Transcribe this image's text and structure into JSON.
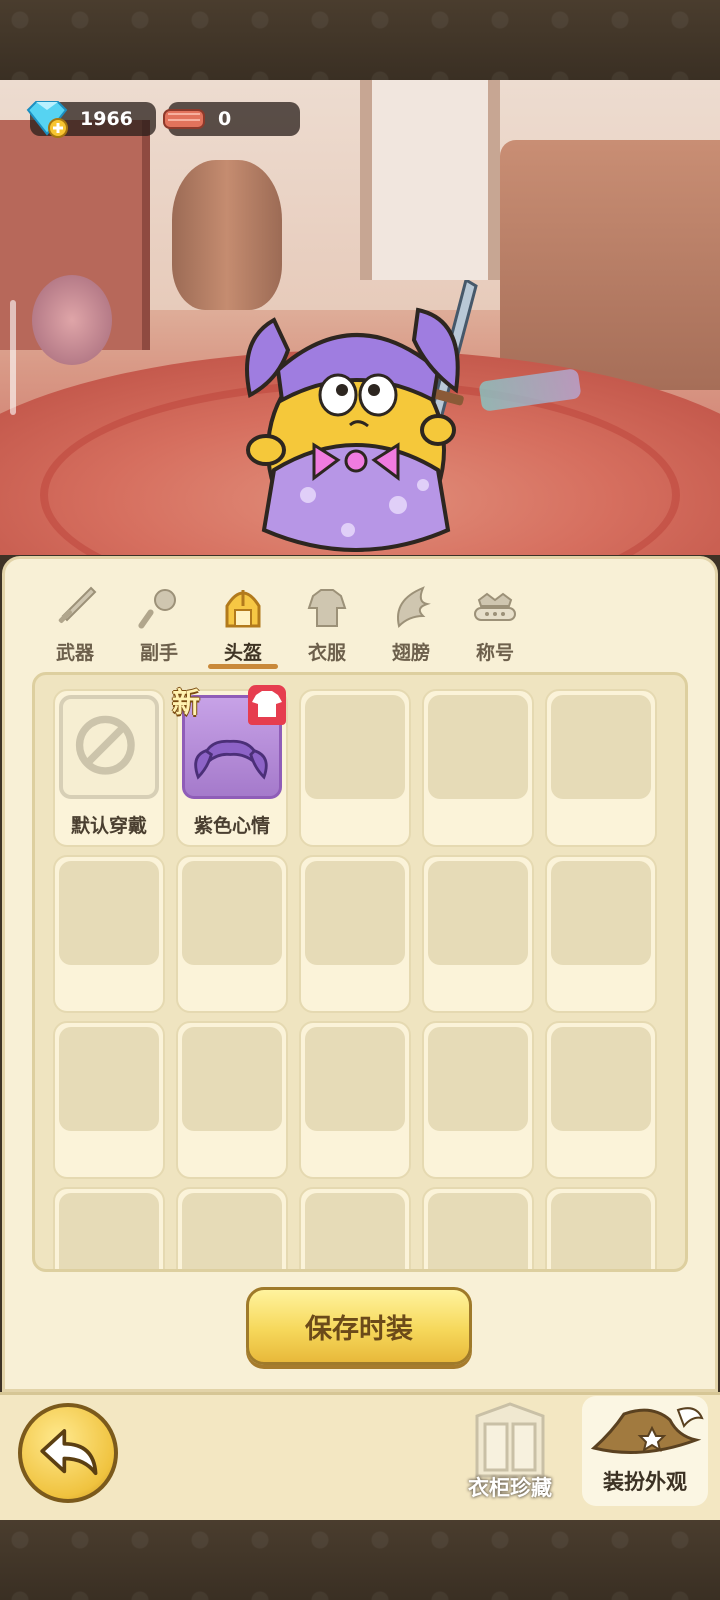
{
  "currency": {
    "gems": "1966",
    "cloth": "0"
  },
  "tabs": [
    {
      "label": "武器",
      "icon": "sword-icon",
      "active": false
    },
    {
      "label": "副手",
      "icon": "offhand-icon",
      "active": false
    },
    {
      "label": "头盔",
      "icon": "helmet-icon",
      "active": true
    },
    {
      "label": "衣服",
      "icon": "armor-icon",
      "active": false
    },
    {
      "label": "翅膀",
      "icon": "wing-icon",
      "active": false
    },
    {
      "label": "称号",
      "icon": "title-crown-icon",
      "active": false
    }
  ],
  "items": [
    {
      "label": "默认穿戴",
      "icon": "forbidden-icon"
    },
    {
      "label": "紫色心情",
      "icon": "purple-pigtails-icon",
      "new_tag": "新",
      "badge_icon": "shirt-icon"
    }
  ],
  "save_button": "保存时装",
  "bottom": {
    "wardrobe": "衣柜珍藏",
    "dressup": "装扮外观"
  },
  "colors": {
    "panel": "#f8f0d6",
    "accent": "#c9893a",
    "button": "#f6d85b"
  }
}
